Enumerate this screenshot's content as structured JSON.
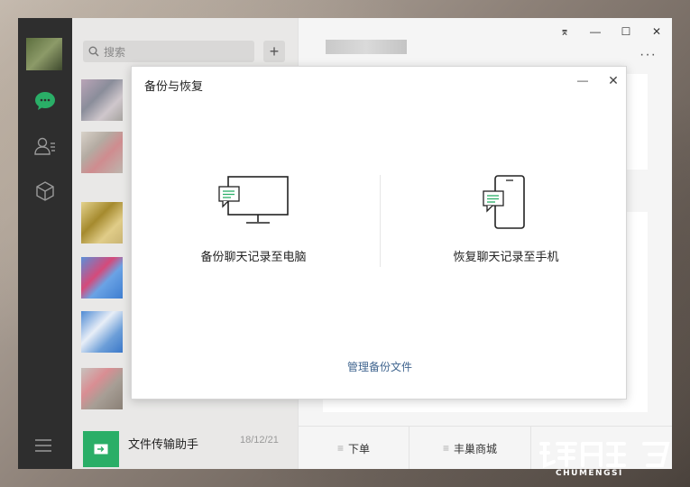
{
  "window": {
    "controls": {
      "pin": "⌆",
      "minimize": "—",
      "maximize": "☐",
      "close": "✕"
    },
    "more": "···"
  },
  "search": {
    "placeholder": "搜索"
  },
  "chat_list": {
    "file_helper": {
      "name": "文件传输助手",
      "time": "18/12/21"
    }
  },
  "bottom_tabs": [
    {
      "label": "下单"
    },
    {
      "label": "丰巢商城"
    }
  ],
  "dialog": {
    "title": "备份与恢复",
    "minimize": "—",
    "close": "✕",
    "backup_option": "备份聊天记录至电脑",
    "restore_option": "恢复聊天记录至手机",
    "manage_link": "管理备份文件"
  },
  "colors": {
    "accent_green": "#2aae67",
    "link_blue": "#40658f",
    "rail_bg": "#2e2e2e"
  },
  "watermark": {
    "text": "CHUMENGSI"
  }
}
